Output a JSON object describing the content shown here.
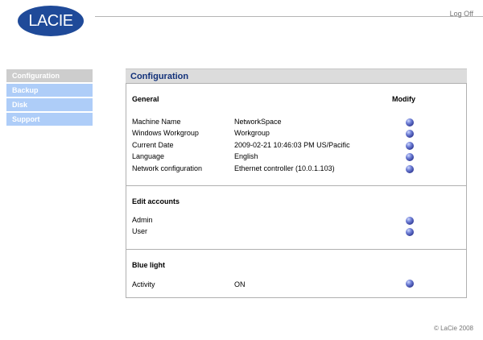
{
  "header": {
    "logo_text": "LACIE",
    "logoff_label": "Log Off"
  },
  "nav": {
    "items": [
      {
        "label": "Configuration",
        "active": true
      },
      {
        "label": "Backup",
        "active": false
      },
      {
        "label": "Disk",
        "active": false
      },
      {
        "label": "Support",
        "active": false
      }
    ]
  },
  "panel": {
    "title": "Configuration",
    "modify_header": "Modify",
    "sections": {
      "general": {
        "title": "General",
        "rows": [
          {
            "label": "Machine Name",
            "value": "NetworkSpace"
          },
          {
            "label": "Windows Workgroup",
            "value": "Workgroup"
          },
          {
            "label": "Current Date",
            "value": "2009-02-21 10:46:03 PM US/Pacific"
          },
          {
            "label": "Language",
            "value": "English"
          },
          {
            "label": "Network configuration",
            "value": "Ethernet controller (10.0.1.103)"
          }
        ]
      },
      "accounts": {
        "title": "Edit accounts",
        "rows": [
          {
            "label": "Admin",
            "value": ""
          },
          {
            "label": "User",
            "value": ""
          }
        ]
      },
      "bluelight": {
        "title": "Blue light",
        "rows": [
          {
            "label": "Activity",
            "value": "ON"
          }
        ]
      }
    }
  },
  "footer": {
    "copyright": "© LaCie 2008"
  }
}
